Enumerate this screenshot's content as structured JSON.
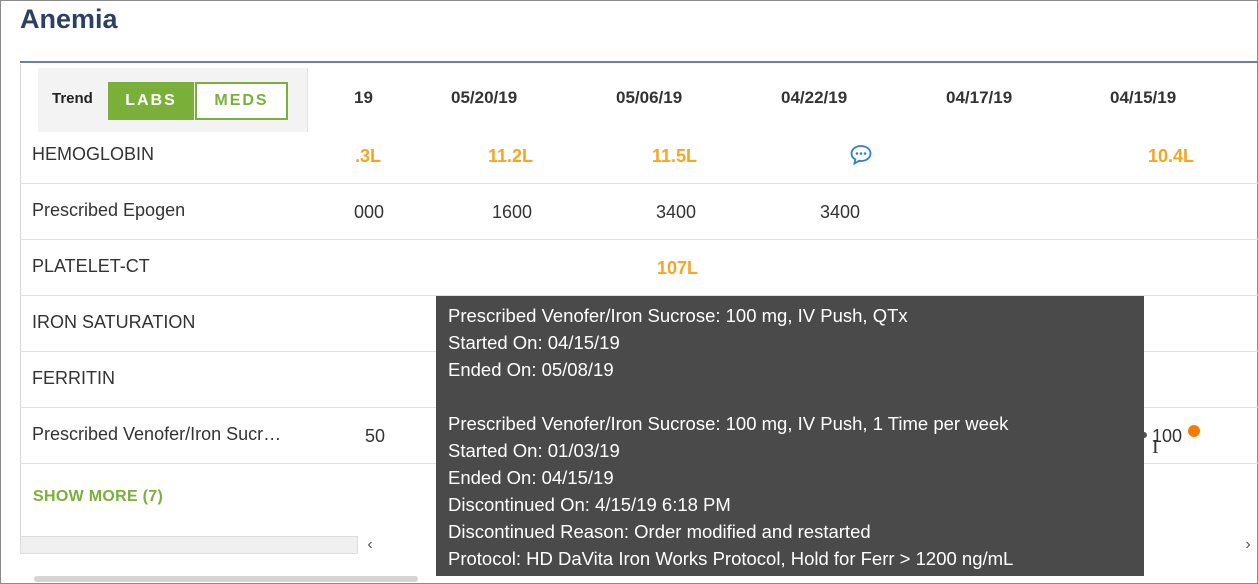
{
  "panel": {
    "title": "Anemia"
  },
  "trend": {
    "label": "Trend",
    "labs_label": "LABS",
    "meds_label": "MEDS"
  },
  "dates": [
    "19",
    "05/20/19",
    "05/06/19",
    "04/22/19",
    "04/17/19",
    "04/15/19"
  ],
  "rows": [
    {
      "label": "HEMOGLOBIN",
      "values": [
        ".3L",
        "11.2L",
        "11.5L",
        "",
        "",
        "10.4L"
      ]
    },
    {
      "label": "Prescribed Epogen",
      "values": [
        "000",
        "1600",
        "3400",
        "3400",
        "",
        ""
      ]
    },
    {
      "label": "PLATELET-CT",
      "values": [
        "",
        "",
        "107L",
        "",
        "",
        ""
      ]
    },
    {
      "label": "IRON SATURATION",
      "values": [
        "",
        "",
        "",
        "",
        "",
        ""
      ]
    },
    {
      "label": "FERRITIN",
      "values": [
        "",
        "",
        "",
        "",
        "",
        ""
      ]
    },
    {
      "label": "Prescribed Venofer/Iron Sucr…",
      "values": [
        "50",
        "",
        "",
        "",
        "",
        "100"
      ]
    }
  ],
  "show_more": {
    "label": "SHOW MORE",
    "count": "(7)"
  },
  "icons": {
    "comment": "comment-bubble-icon",
    "scroll_left": "chevron-left-icon",
    "scroll_right": "chevron-right-icon",
    "cursor": "text-cursor-icon"
  },
  "scroll": {
    "left_glyph": "‹",
    "right_glyph": "›"
  },
  "cursor_glyph": "I",
  "colors": {
    "accent_green": "#7ab03a",
    "abnormal_orange": "#f5a623",
    "title_navy": "#2e3f66",
    "tooltip_bg": "#4a4a4a",
    "marker_orange": "#f57c00"
  },
  "tooltip": {
    "entries": [
      {
        "title": "Prescribed Venofer/Iron Sucrose: 100 mg, IV Push, QTx",
        "started": "Started On: 04/15/19",
        "ended": "Ended On: 05/08/19"
      },
      {
        "title": "Prescribed Venofer/Iron Sucrose: 100 mg, IV Push, 1 Time per week",
        "started": "Started On: 01/03/19",
        "ended": "Ended On: 04/15/19",
        "discontinued_on": "Discontinued On: 4/15/19 6:18 PM",
        "discontinued_reason": "Discontinued Reason: Order modified and restarted",
        "protocol": "Protocol: HD DaVita Iron Works Protocol, Hold for Ferr > 1200 ng/mL"
      }
    ]
  }
}
